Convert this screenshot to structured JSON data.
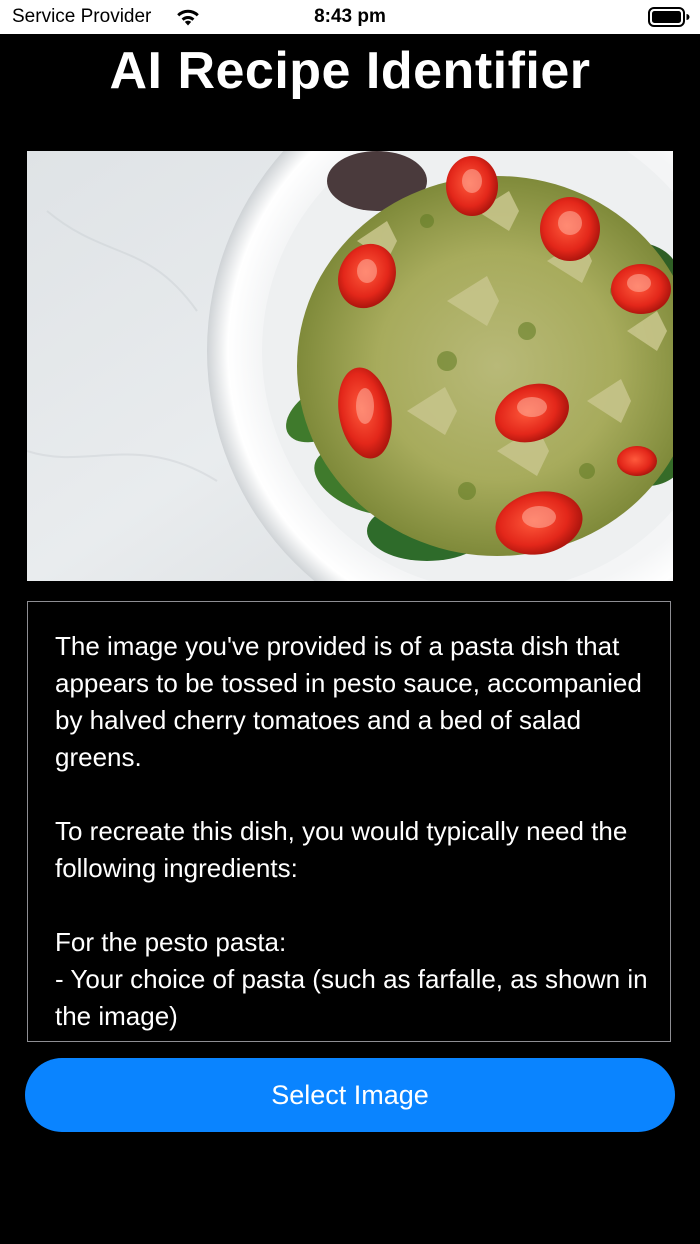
{
  "status_bar": {
    "carrier": "Service Provider",
    "time": "8:43 pm",
    "wifi_icon": "wifi-icon",
    "battery_icon": "battery-full-icon"
  },
  "app": {
    "title": "AI Recipe Identifier",
    "background_color": "#000000"
  },
  "image": {
    "description_icon": "pasta-dish-photo"
  },
  "result": {
    "text": "The image you've provided is of a pasta dish that appears to be tossed in pesto sauce, accompanied by halved cherry tomatoes and a bed of salad greens.\n\nTo recreate this dish, you would typically need the following ingredients:\n\nFor the pesto pasta:\n- Your choice of pasta (such as farfalle, as shown in the image)"
  },
  "button": {
    "label": "Select Image",
    "color": "#0a84ff"
  }
}
